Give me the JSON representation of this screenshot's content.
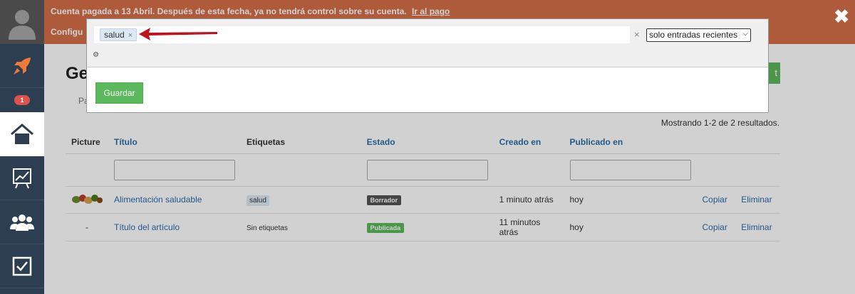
{
  "banner": {
    "message": "Cuenta pagada a 13 Abril. Después de esta fecha, ya no tendrá control sobre su cuenta.",
    "link": "Ir al pago",
    "config": "Configu"
  },
  "sidebar": {
    "badge_count": "1",
    "items": [
      {
        "icon": "avatar-icon"
      },
      {
        "icon": "rocket-icon"
      },
      {
        "icon": "home-icon"
      },
      {
        "icon": "chart-icon"
      },
      {
        "icon": "users-icon"
      },
      {
        "icon": "checkbox-icon"
      }
    ]
  },
  "page": {
    "title": "Ge",
    "new_button": "t",
    "tab_hint": "Pa",
    "results": "Mostrando 1-2 de 2 resultados."
  },
  "table": {
    "headers": [
      "Picture",
      "Título",
      "Etiquetas",
      "Estado",
      "Creado en",
      "Publicado en"
    ],
    "rows": [
      {
        "picture": "",
        "title": "Alimentación saludable",
        "tags": "salud",
        "status": "Borrador",
        "created": "1 minuto atrás",
        "published": "hoy",
        "copy": "Copiar",
        "delete": "Eliminar"
      },
      {
        "picture": "-",
        "title": "Título del artículo",
        "tags": "Sin etiquetas",
        "status": "Publicada",
        "created": "11 minutos atrás",
        "published": "hoy",
        "copy": "Copiar",
        "delete": "Eliminar"
      }
    ]
  },
  "modal": {
    "chip_label": "salud",
    "chip_remove": "×",
    "clear": "×",
    "select_value": "solo entradas recientes",
    "save_label": "Guardar"
  },
  "colors": {
    "banner": "#d5704a",
    "sidebar": "#2c3e50",
    "accent_green": "#5cb85c",
    "link_blue": "#2a6da8",
    "arrow_red": "#c0121b"
  }
}
